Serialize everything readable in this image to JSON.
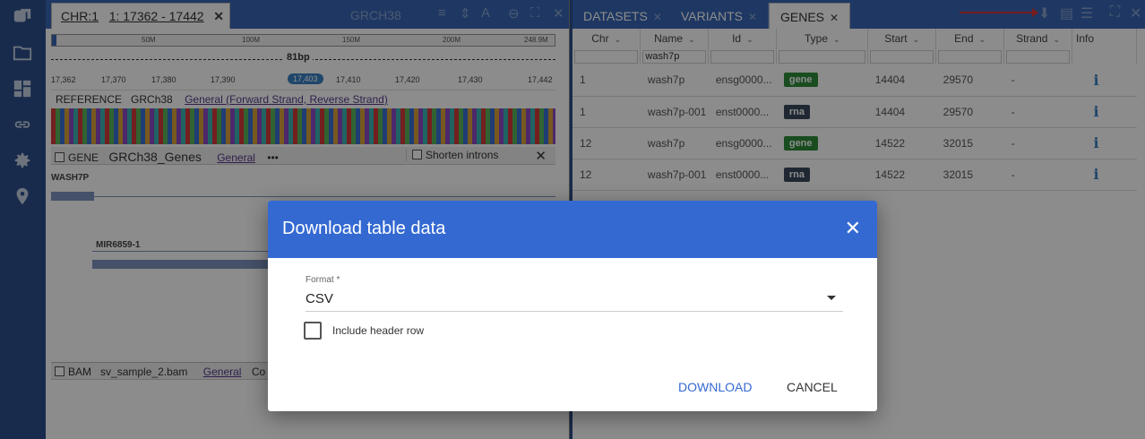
{
  "sidebar": {
    "icons": [
      "logo-icon",
      "folder-icon",
      "dashboard-icon",
      "link-icon",
      "settings-icon",
      "location-icon"
    ]
  },
  "browser": {
    "tab_chr": "CHR:1",
    "tab_range": "1: 17362 - 17442",
    "reference_label": "GRCH38",
    "ruler_ticks": [
      "50M",
      "100M",
      "150M",
      "200M",
      "248.9M"
    ],
    "span_label": "81bp",
    "coords": [
      "17,362",
      "17,370",
      "17,380",
      "17,390",
      "17,403",
      "17,410",
      "17,420",
      "17,430",
      "17,442"
    ],
    "selected_coord": "17,403",
    "reference_row": {
      "title": "REFERENCE",
      "genome": "GRCh38",
      "link": "General (Forward Strand, Reverse Strand)"
    },
    "gene_track": {
      "type": "GENE",
      "name": "GRCh38_Genes",
      "link": "General",
      "more": "•••",
      "shorten": "Shorten introns",
      "genes": [
        "WASH7P",
        "MIR6859-1"
      ]
    },
    "bam_track": {
      "type": "BAM",
      "name": "sv_sample_2.bam",
      "link": "General",
      "extra": "Co"
    }
  },
  "table": {
    "tabs": [
      "DATASETS",
      "VARIANTS",
      "GENES"
    ],
    "active_tab": "GENES",
    "columns": [
      "Chr",
      "Name",
      "Id",
      "Type",
      "Start",
      "End",
      "Strand",
      "Info"
    ],
    "name_filter": "wash7p",
    "rows": [
      {
        "chr": "1",
        "name": "wash7p",
        "id": "ensg0000...",
        "type": "gene",
        "start": "14404",
        "end": "29570",
        "strand": "-",
        "info": "i"
      },
      {
        "chr": "1",
        "name": "wash7p-001",
        "id": "enst0000...",
        "type": "rna",
        "start": "14404",
        "end": "29570",
        "strand": "-",
        "info": "i"
      },
      {
        "chr": "12",
        "name": "wash7p",
        "id": "ensg0000...",
        "type": "gene",
        "start": "14522",
        "end": "32015",
        "strand": "-",
        "info": "i"
      },
      {
        "chr": "12",
        "name": "wash7p-001",
        "id": "enst0000...",
        "type": "rna",
        "start": "14522",
        "end": "32015",
        "strand": "-",
        "info": "i"
      }
    ]
  },
  "dialog": {
    "title": "Download table data",
    "format_label": "Format *",
    "format_value": "CSV",
    "include_header_label": "Include header row",
    "include_header_checked": false,
    "download_label": "DOWNLOAD",
    "cancel_label": "CANCEL"
  },
  "colors": {
    "accent": "#3469d2",
    "sidebar": "#2c4f8a",
    "gene_badge": "#2e8b3a",
    "rna_badge": "#3a4a5c"
  }
}
